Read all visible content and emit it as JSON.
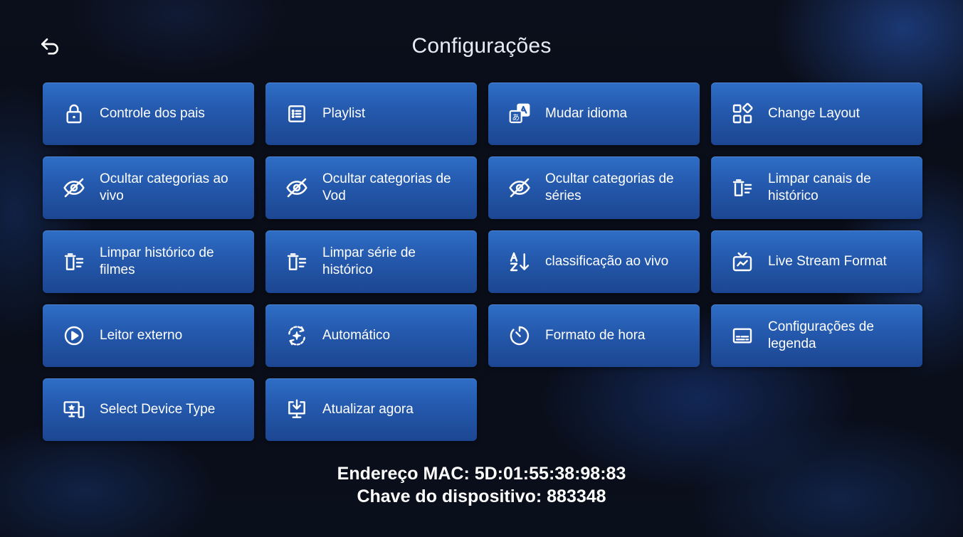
{
  "header": {
    "title": "Configurações",
    "back_icon": "back-arrow-icon"
  },
  "items": [
    {
      "label": "Controle dos pais",
      "icon": "lock-icon"
    },
    {
      "label": "Playlist",
      "icon": "playlist-icon"
    },
    {
      "label": "Mudar idioma",
      "icon": "translate-icon"
    },
    {
      "label": "Change Layout",
      "icon": "layout-icon"
    },
    {
      "label": "Ocultar categorias ao vivo",
      "icon": "eye-off-icon"
    },
    {
      "label": "Ocultar categorias de Vod",
      "icon": "eye-off-icon"
    },
    {
      "label": "Ocultar categorias de séries",
      "icon": "eye-off-icon"
    },
    {
      "label": "Limpar canais de histórico",
      "icon": "clear-history-icon"
    },
    {
      "label": "Limpar histórico de filmes",
      "icon": "clear-history-icon"
    },
    {
      "label": "Limpar série de histórico",
      "icon": "clear-history-icon"
    },
    {
      "label": "classificação ao vivo",
      "icon": "sort-az-icon"
    },
    {
      "label": "Live Stream Format",
      "icon": "live-tv-icon"
    },
    {
      "label": "Leitor externo",
      "icon": "play-circle-icon"
    },
    {
      "label": "Automático",
      "icon": "auto-refresh-icon"
    },
    {
      "label": "Formato de hora",
      "icon": "timer-icon"
    },
    {
      "label": "Configurações de legenda",
      "icon": "subtitles-icon"
    },
    {
      "label": "Select Device Type",
      "icon": "device-type-icon"
    },
    {
      "label": "Atualizar agora",
      "icon": "download-update-icon"
    }
  ],
  "footer": {
    "mac_address": "Endereço MAC: 5D:01:55:38:98:83",
    "device_key": "Chave do dispositivo: 883348"
  }
}
